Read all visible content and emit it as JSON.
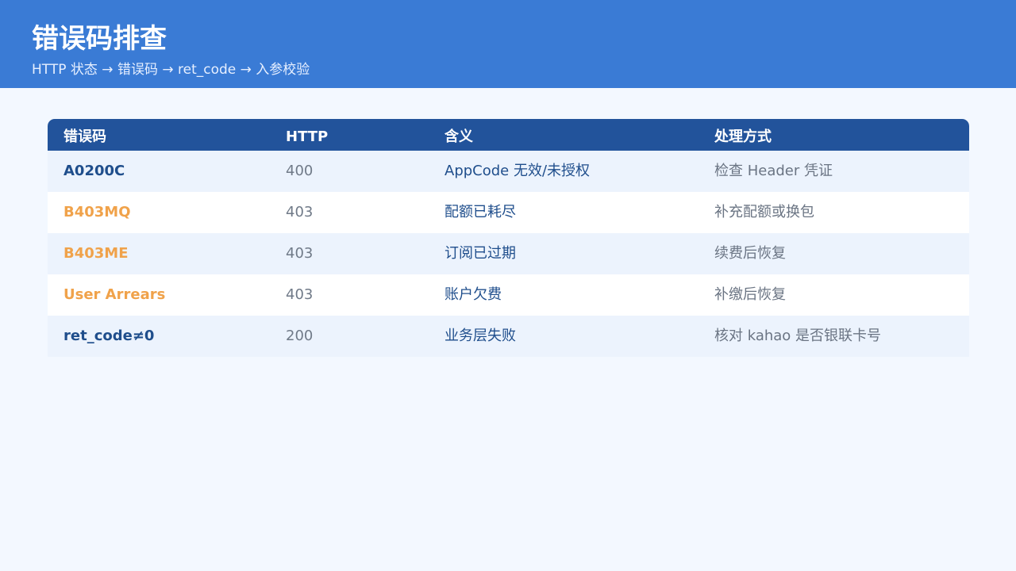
{
  "header": {
    "title": "错误码排查",
    "subtitle": "HTTP 状态 → 错误码 → ret_code → 入参校验",
    "background_color": "#3a7bd5"
  },
  "table": {
    "columns": [
      "错误码",
      "HTTP",
      "含义",
      "处理方式"
    ],
    "header_color": "#22539b",
    "rows": [
      {
        "code": "A0200C",
        "code_color": "blue",
        "http": "400",
        "meaning": "AppCode 无效/未授权",
        "action": "检查 Header 凭证"
      },
      {
        "code": "B403MQ",
        "code_color": "orange",
        "http": "403",
        "meaning": "配额已耗尽",
        "action": "补充配额或换包"
      },
      {
        "code": "B403ME",
        "code_color": "orange",
        "http": "403",
        "meaning": "订阅已过期",
        "action": "续费后恢复"
      },
      {
        "code": "User Arrears",
        "code_color": "orange",
        "http": "403",
        "meaning": "账户欠费",
        "action": "补缴后恢复"
      },
      {
        "code": "ret_code≠0",
        "code_color": "blue",
        "http": "200",
        "meaning": "业务层失败",
        "action": "核对 kahao 是否银联卡号"
      }
    ]
  },
  "colors": {
    "page_background": "#f3f8ff",
    "code_blue": "#1f4e8c",
    "code_orange": "#f0a24a"
  }
}
